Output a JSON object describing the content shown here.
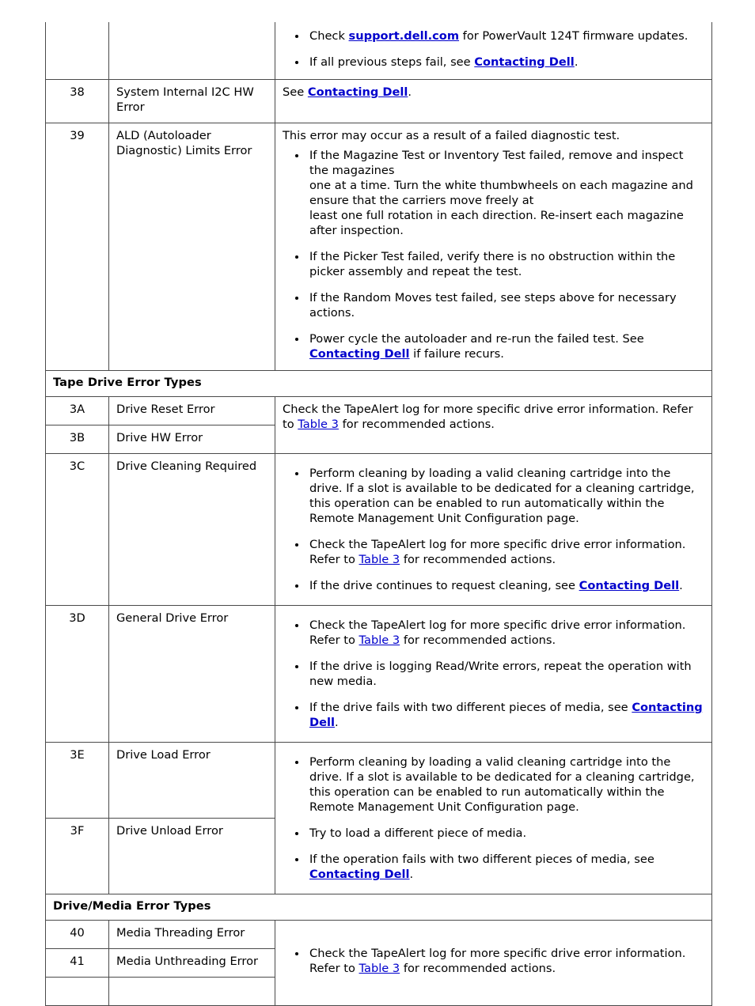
{
  "document": {
    "colors": {
      "link": "#0000cc",
      "border": "#4a4a4a",
      "text": "#000000",
      "background": "#ffffff"
    },
    "links": {
      "contacting_dell": "Contacting Dell",
      "support_dell": "support.dell.com",
      "table3": "Table 3"
    }
  },
  "rows": {
    "clipped_top": {
      "bullet_1_pre": "Check ",
      "bullet_1_post": " for PowerVault 124T firmware updates.",
      "bullet_2_pre": "If all previous steps fail, see ",
      "bullet_2_post": "."
    },
    "r38": {
      "code": "38",
      "name": "System Internal I2C HW Error",
      "desc_pre": "See ",
      "desc_post": "."
    },
    "r39": {
      "code": "39",
      "name": "ALD (Autoloader Diagnostic) Limits Error",
      "lead": "This error may occur as a result of a failed diagnostic test.",
      "b1_l1": "If the Magazine Test or Inventory Test failed, remove and inspect the magazines",
      "b1_l2": "one at a time. Turn the white thumbwheels on each magazine and ensure that the carriers move freely at",
      "b1_l3": "least one full rotation in each direction. Re-insert each magazine after inspection.",
      "b2": "If the Picker Test failed, verify there is no obstruction within the picker assembly and repeat the test.",
      "b3": "If the Random Moves test failed, see steps above for necessary actions.",
      "b4_pre": "Power cycle the autoloader and re-run the failed test. See ",
      "b4_post": " if failure recurs."
    },
    "section_tape": {
      "title": "Tape Drive Error Types"
    },
    "r3A": {
      "code": "3A",
      "name": "Drive Reset Error"
    },
    "r3B": {
      "code": "3B",
      "name": "Drive HW Error"
    },
    "r3AB_desc": {
      "pre": "Check the TapeAlert log for more specific drive error information. Refer to ",
      "post": " for recommended actions."
    },
    "r3C": {
      "code": "3C",
      "name": "Drive Cleaning Required",
      "b1": "Perform cleaning by loading a valid cleaning cartridge into the drive. If a slot is available to be dedicated for a cleaning cartridge, this operation can be enabled to run automatically within the Remote Management Unit Configuration page.",
      "b2_pre": "Check the TapeAlert log for more specific drive error information. Refer to ",
      "b2_post": " for recommended actions.",
      "b3_pre": "If the drive continues to request cleaning, see ",
      "b3_post": "."
    },
    "r3D": {
      "code": "3D",
      "name": "General Drive Error",
      "b1_pre": "Check the TapeAlert log for more specific drive error information. Refer to ",
      "b1_post": " for recommended actions.",
      "b2": "If the drive is logging Read/Write errors, repeat the operation with new media.",
      "b3_pre": "If the drive fails with two different pieces of media, see ",
      "b3_post": "."
    },
    "r3E": {
      "code": "3E",
      "name": "Drive Load Error"
    },
    "r3F": {
      "code": "3F",
      "name": "Drive Unload Error"
    },
    "r3EF_desc": {
      "b1": "Perform cleaning by loading a valid cleaning cartridge into the drive. If a slot is available to be dedicated for a cleaning cartridge, this operation can be enabled to run automatically within the Remote Management Unit Configuration page.",
      "b2": "Try to load a different piece of media.",
      "b3_pre": "If the operation fails with two different pieces of media, see ",
      "b3_post": "."
    },
    "section_media": {
      "title": "Drive/Media Error Types"
    },
    "r40": {
      "code": "40",
      "name": "Media Threading Error"
    },
    "r41": {
      "code": "41",
      "name": "Media Unthreading Error"
    },
    "r4041_desc": {
      "pre": "Check the TapeAlert log for more specific drive error information. Refer to ",
      "post": " for recommended actions."
    }
  }
}
